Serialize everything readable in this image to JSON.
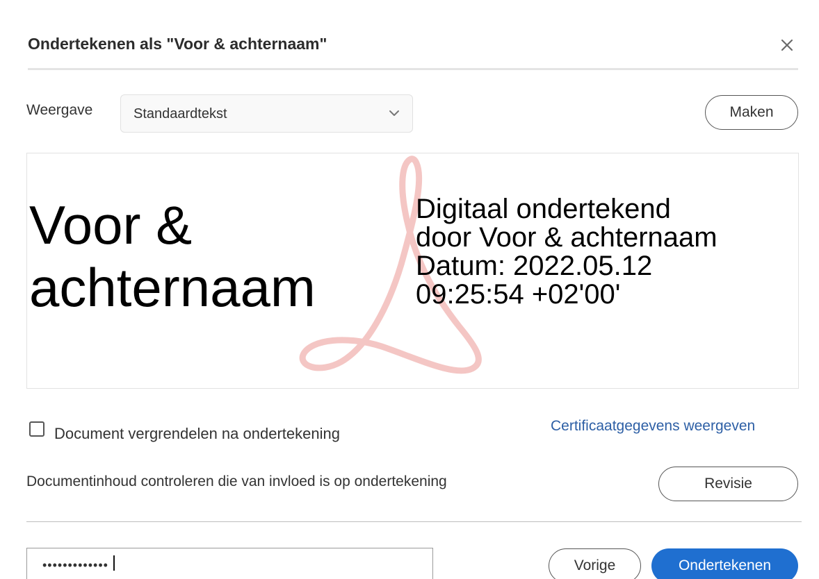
{
  "dialog": {
    "title": "Ondertekenen als \"Voor & achternaam\"",
    "close_icon": "close-icon"
  },
  "appearance": {
    "label": "Weergave",
    "selected": "Standaardtekst",
    "create_button": "Maken"
  },
  "preview": {
    "name_lines": [
      "Voor &",
      "achternaam"
    ],
    "detail_lines": [
      "Digitaal ondertekend",
      "door Voor & achternaam",
      "Datum: 2022.05.12",
      "09:25:54 +02'00'"
    ],
    "watermark_icon": "acrobat-logo-icon",
    "watermark_color": "#f4c6c4"
  },
  "options": {
    "lock_document_label": "Document vergrendelen na ondertekening",
    "lock_document_checked": false,
    "certificate_link": "Certificaatgegevens weergeven",
    "review_label": "Documentinhoud controleren die van invloed is op ondertekening",
    "review_button": "Revisie"
  },
  "footer": {
    "password_value": "•••••••••••••",
    "back_button": "Vorige",
    "sign_button": "Ondertekenen"
  },
  "colors": {
    "accent": "#1f6fd0",
    "link": "#2d5fa5"
  }
}
